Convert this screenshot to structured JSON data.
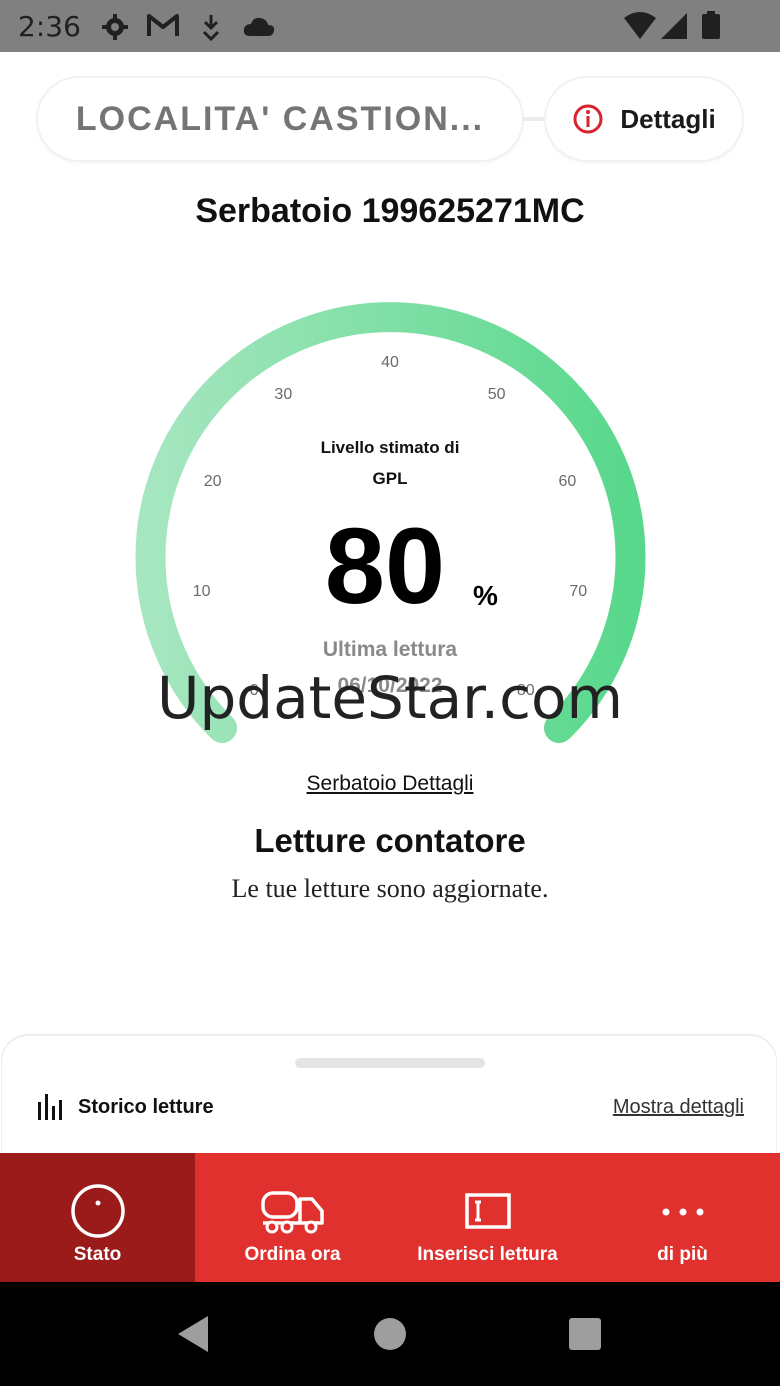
{
  "status_bar": {
    "time": "2:36"
  },
  "header": {
    "location": "LOCALITA' CASTION...",
    "details_label": "Dettagli"
  },
  "tank": {
    "title": "Serbatoio 199625271MC",
    "details_link": "Serbatoio Dettagli"
  },
  "gauge": {
    "caption_line1": "Livello stimato di",
    "caption_line2": "GPL",
    "value": "80",
    "unit": "%",
    "level_percent": 80,
    "last_reading_label": "Ultima lettura",
    "last_reading_date": "06/10/2022",
    "ticks": [
      "0",
      "10",
      "20",
      "30",
      "40",
      "50",
      "60",
      "70",
      "80"
    ],
    "colors": {
      "arc_start": "#a6e6c0",
      "arc_end": "#58d88b"
    }
  },
  "watermark": "UpdateStar.com",
  "readings": {
    "title": "Letture contatore",
    "subtitle": "Le tue letture sono aggiornate."
  },
  "history": {
    "label": "Storico letture",
    "show_details": "Mostra dettagli"
  },
  "nav": {
    "items": [
      {
        "label": "Stato",
        "icon": "gauge-icon"
      },
      {
        "label": "Ordina ora",
        "icon": "truck-icon"
      },
      {
        "label": "Inserisci lettura",
        "icon": "meter-input-icon"
      },
      {
        "label": "di più",
        "icon": "more-dots-icon"
      }
    ],
    "colors": {
      "bar": "#e0312e",
      "active": "#9a1b19"
    }
  }
}
